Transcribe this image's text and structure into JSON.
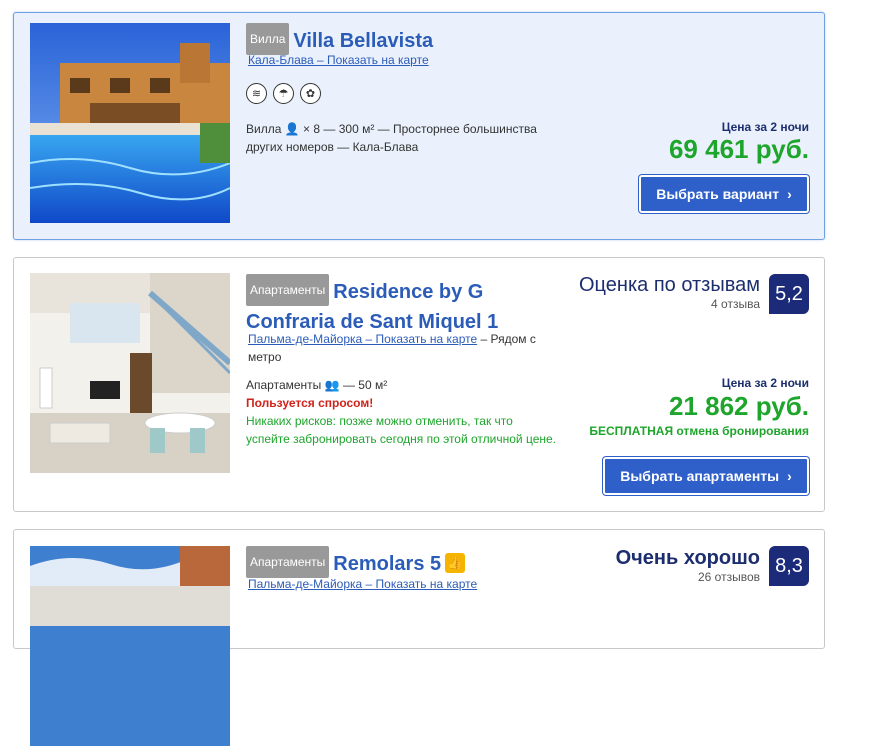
{
  "listings": [
    {
      "type": "Вилла",
      "name": "Villa Bellavista",
      "location": "Кала-Блава – Показать на карте",
      "facilities": [
        "swimming-icon",
        "beach-umbrella-icon",
        "garden-icon"
      ],
      "desc_type": "Вилла",
      "desc_guests": "× 8",
      "desc_rest": "— 300 м² — Просторнее большинства",
      "desc_line2": "других номеров — Кала-Блава",
      "price_label": "Цена за 2 ночи",
      "price": "69 461 руб.",
      "button": "Выбрать вариант"
    },
    {
      "type": "Апартаменты",
      "name_line1": "Residence by G",
      "name_line2": "Confraria de Sant Miquel 1",
      "location": "Пальма-де-Майорка – Показать на карте",
      "location_extra": " – Рядом с",
      "location_extra2": "метро",
      "desc": "Апартаменты",
      "desc_rest": "— 50 м²",
      "demand": "Пользуется спросом!",
      "norisk_line1": "Никаких рисков: позже можно отменить, так что",
      "norisk_line2": "успейте забронировать сегодня по этой отличной цене.",
      "review_title": "Оценка по отзывам",
      "review_count": "4 отзыва",
      "score": "5,2",
      "price_label": "Цена за 2 ночи",
      "price": "21 862 руб.",
      "free_cancel": "БЕСПЛАТНАЯ отмена бронирования",
      "button": "Выбрать апартаменты"
    },
    {
      "type": "Апартаменты",
      "name": "Remolars 5",
      "location": "Пальма-де-Майорка – Показать на карте",
      "review_title": "Очень хорошо",
      "review_count": "26 отзывов",
      "score": "8,3"
    }
  ]
}
